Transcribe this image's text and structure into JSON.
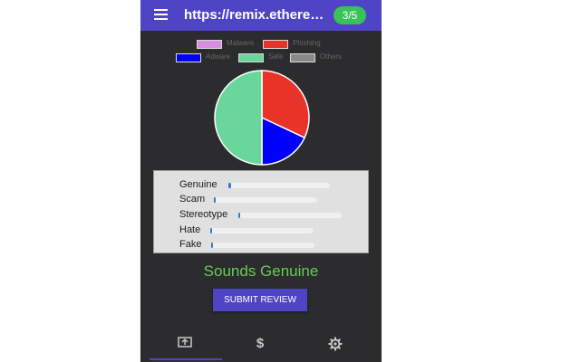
{
  "topbar": {
    "url": "https://remix.ethereum.org",
    "badge": "3/5"
  },
  "legend": [
    {
      "label": "Malware",
      "color": "#d98ee6"
    },
    {
      "label": "Phishing",
      "color": "#e8332a"
    },
    {
      "label": "Adware",
      "color": "#0000ff"
    },
    {
      "label": "Safe",
      "color": "#6ad69b"
    },
    {
      "label": "Others",
      "color": "#8a8a8a"
    }
  ],
  "chart_data": {
    "type": "pie",
    "slices": [
      {
        "label": "Phishing",
        "value": 32,
        "color": "#e8332a"
      },
      {
        "label": "Adware",
        "value": 18,
        "color": "#0000ff"
      },
      {
        "label": "Safe",
        "value": 50,
        "color": "#6ad69b"
      }
    ]
  },
  "scores": [
    {
      "label": "Genuine",
      "value": 0.03
    },
    {
      "label": "Scam",
      "value": 0.02
    },
    {
      "label": "Stereotype",
      "value": 0.02
    },
    {
      "label": "Hate",
      "value": 0.02
    },
    {
      "label": "Fake",
      "value": 0.02
    }
  ],
  "verdict": "Sounds Genuine",
  "submit_label": "SUBMIT REVIEW",
  "nav": [
    {
      "icon": "report-icon"
    },
    {
      "icon": "dollar-icon"
    },
    {
      "icon": "gear-icon"
    }
  ]
}
